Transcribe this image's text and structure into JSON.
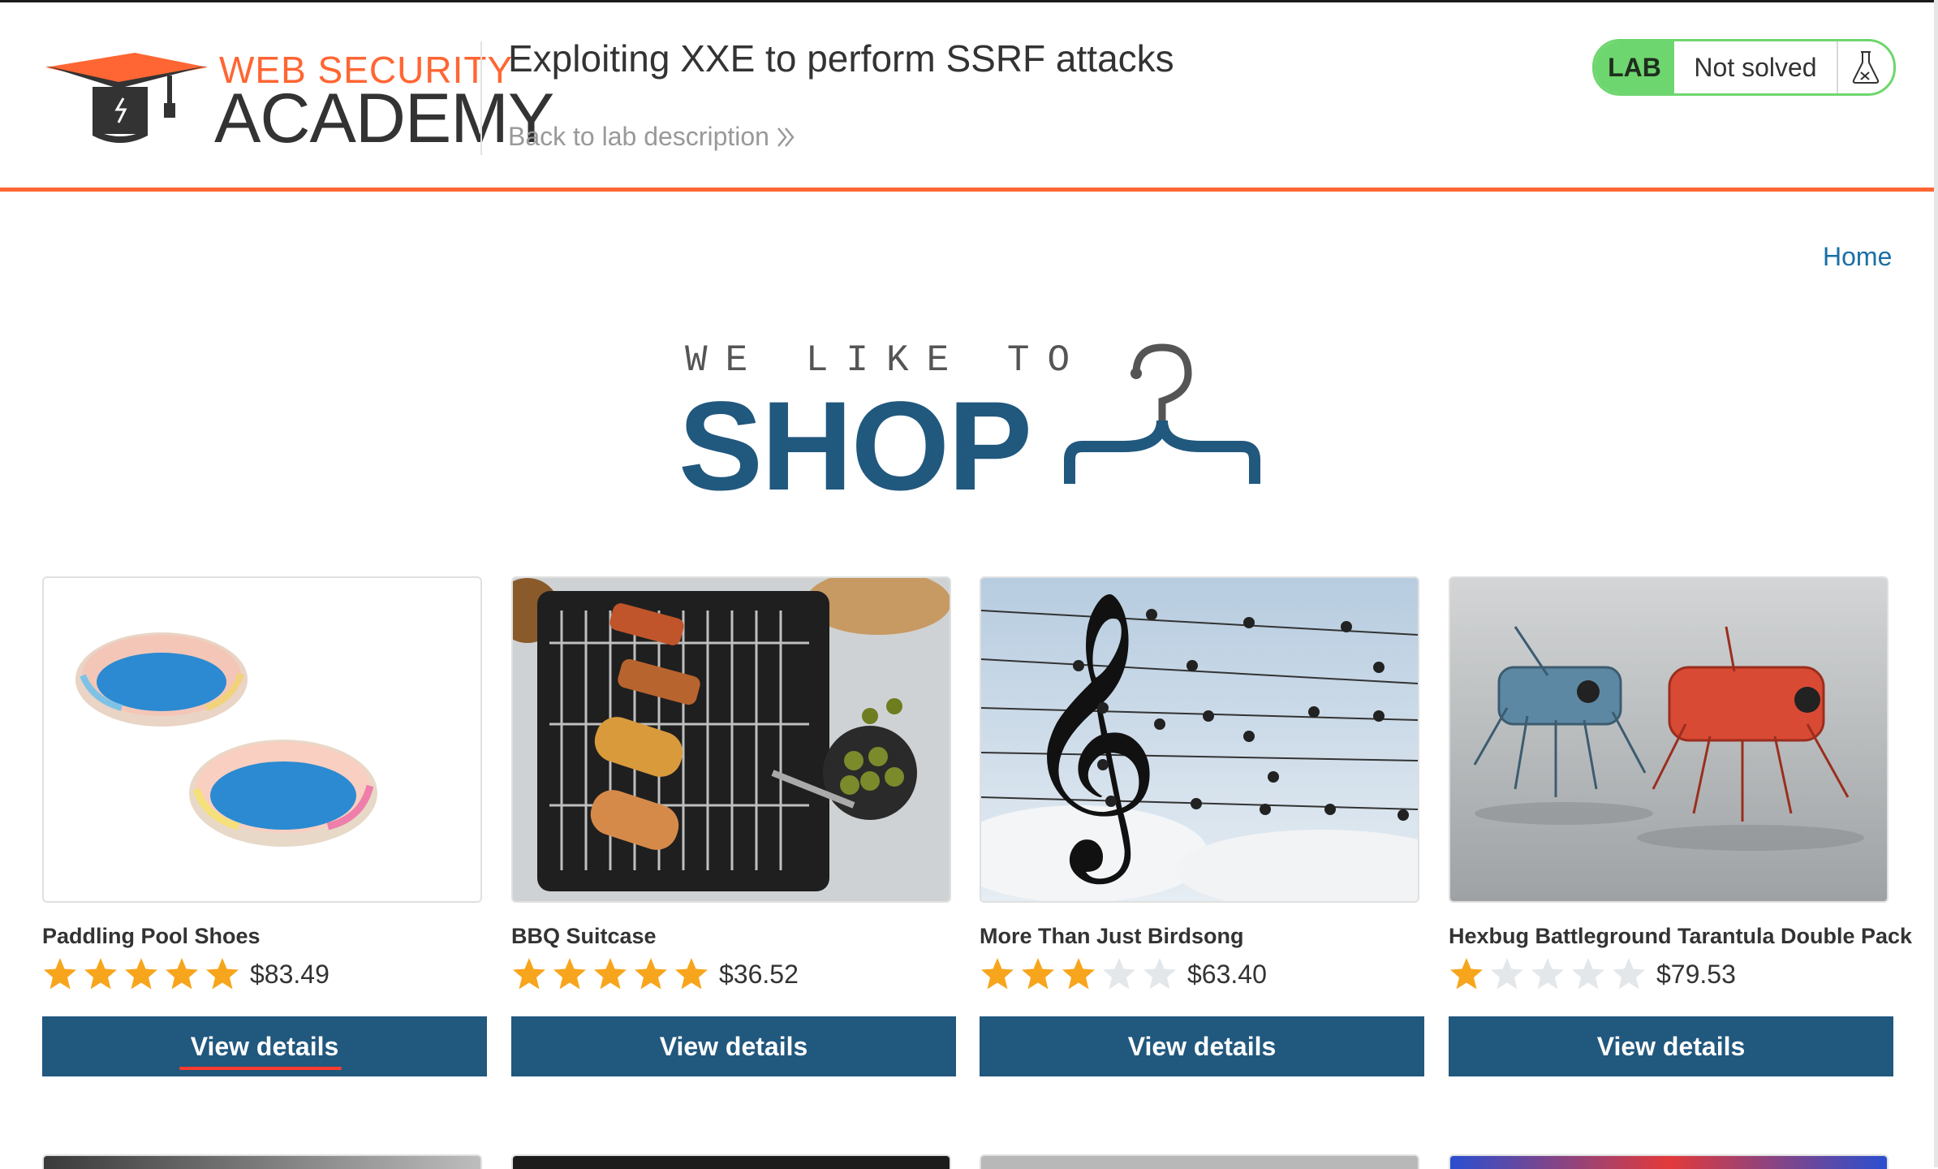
{
  "header": {
    "logo_top": "WEB SECURITY",
    "logo_bottom": "ACADEMY",
    "lab_title": "Exploiting XXE to perform SSRF attacks",
    "back_link": "Back to lab description",
    "lab_badge": "LAB",
    "lab_status": "Not solved"
  },
  "nav": {
    "home": "Home"
  },
  "banner": {
    "small": "WE LIKE TO",
    "big": "SHOP"
  },
  "products": [
    {
      "name": "Paddling Pool Shoes",
      "rating": 5,
      "price": "$83.49",
      "button": "View details",
      "image": "paddling-pool-image"
    },
    {
      "name": "BBQ Suitcase",
      "rating": 5,
      "price": "$36.52",
      "button": "View details",
      "image": "bbq-grill-image"
    },
    {
      "name": "More Than Just Birdsong",
      "rating": 3,
      "price": "$63.40",
      "button": "View details",
      "image": "birds-on-wires-image"
    },
    {
      "name": "Hexbug Battleground Tarantula Double Pack",
      "rating": 1,
      "price": "$79.53",
      "button": "View details",
      "image": "robot-spiders-image"
    }
  ],
  "colors": {
    "accent": "#ff6633",
    "brand_blue": "#21587e",
    "lab_green": "#6ed66e",
    "link_blue": "#1a6fa6",
    "star_on": "#f7a51c",
    "star_off": "#e3e7ea"
  }
}
